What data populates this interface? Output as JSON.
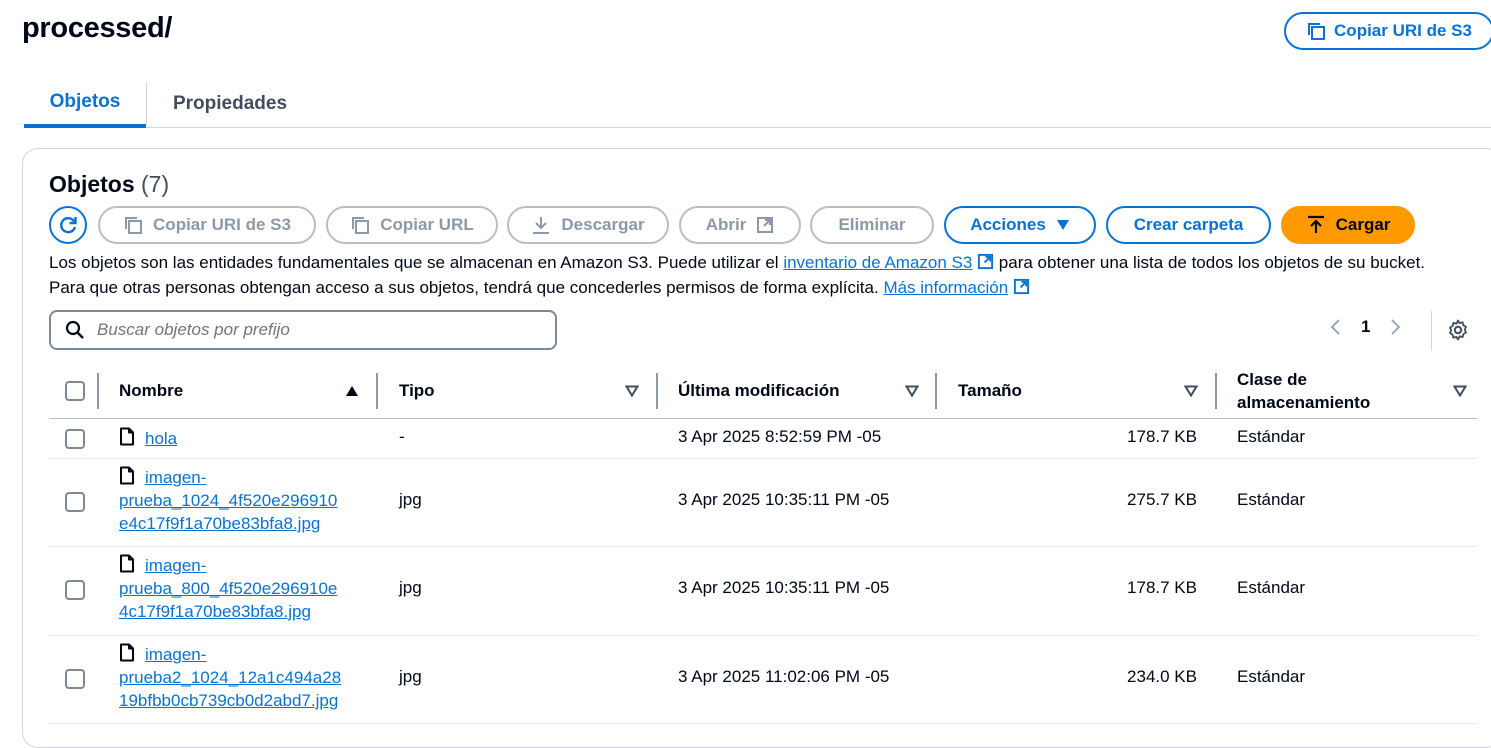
{
  "page": {
    "title": "processed/",
    "copy_uri_button": "Copiar URI de S3"
  },
  "tabs": [
    {
      "label": "Objetos"
    },
    {
      "label": "Propiedades"
    }
  ],
  "objects": {
    "heading": "Objetos",
    "count": "(7)",
    "toolbar": {
      "copy_uri": "Copiar URI de S3",
      "copy_url": "Copiar URL",
      "download": "Descargar",
      "open": "Abrir",
      "delete": "Eliminar",
      "actions": "Acciones",
      "create_folder": "Crear carpeta",
      "upload": "Cargar"
    },
    "description": {
      "text1": "Los objetos son las entidades fundamentales que se almacenan en Amazon S3. Puede utilizar el ",
      "link1": "inventario de Amazon S3",
      "text2": " para obtener una lista de todos los objetos de su bucket. Para que otras personas obtengan acceso a sus objetos, tendrá que concederles permisos de forma explícita. ",
      "link2": "Más información"
    },
    "search": {
      "placeholder": "Buscar objetos por prefijo"
    },
    "pagination": {
      "current_page": "1"
    },
    "columns": {
      "name": "Nombre",
      "type": "Tipo",
      "last_modified": "Última modificación",
      "size": "Tamaño",
      "storage_class_line1": "Clase de",
      "storage_class_line2": "almacenamiento"
    },
    "rows": [
      {
        "name_lines": [
          "hola"
        ],
        "type": "-",
        "modified": "3 Apr 2025 8:52:59 PM -05",
        "size": "178.7 KB",
        "storage": "Estándar"
      },
      {
        "name_lines": [
          "imagen-",
          "prueba_1024_4f520e296910",
          "e4c17f9f1a70be83bfa8.jpg"
        ],
        "type": "jpg",
        "modified": "3 Apr 2025 10:35:11 PM -05",
        "size": "275.7 KB",
        "storage": "Estándar"
      },
      {
        "name_lines": [
          "imagen-",
          "prueba_800_4f520e296910e",
          "4c17f9f1a70be83bfa8.jpg"
        ],
        "type": "jpg",
        "modified": "3 Apr 2025 10:35:11 PM -05",
        "size": "178.7 KB",
        "storage": "Estándar"
      },
      {
        "name_lines": [
          "imagen-",
          "prueba2_1024_12a1c494a28",
          "19bfbb0cb739cb0d2abd7.jpg"
        ],
        "type": "jpg",
        "modified": "3 Apr 2025 11:02:06 PM -05",
        "size": "234.0 KB",
        "storage": "Estándar"
      }
    ]
  },
  "colors": {
    "accent": "#0972d3",
    "upload": "#ff9900",
    "disabled": "#8d99a8"
  }
}
